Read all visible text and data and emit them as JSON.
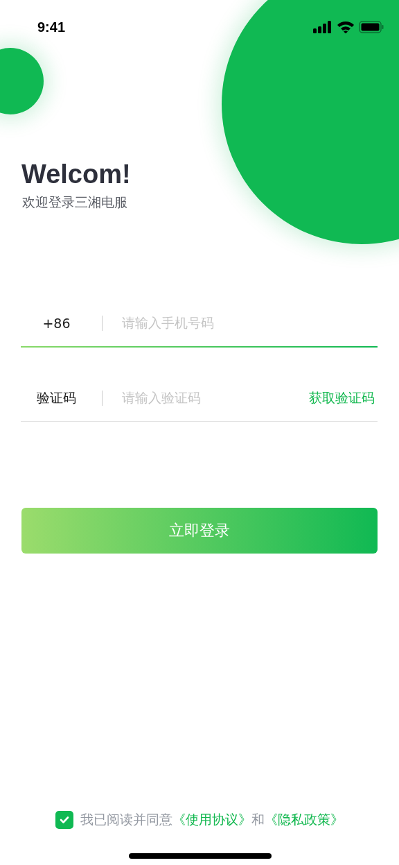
{
  "status_bar": {
    "time": "9:41"
  },
  "heading": {
    "title": "Welcom!",
    "subtitle": "欢迎登录三湘电服"
  },
  "fields": [
    {
      "kind": "phone",
      "prefix": "+86",
      "placeholder": "请输入手机号码",
      "focused": true
    },
    {
      "kind": "code",
      "prefix": "验证码",
      "placeholder": "请输入验证码",
      "action": "获取验证码",
      "focused": false
    }
  ],
  "login_button": "立即登录",
  "agreement": {
    "checked": true,
    "parts": [
      {
        "kind": "text",
        "text": "我已阅读并同意"
      },
      {
        "kind": "link",
        "text": "《使用协议》"
      },
      {
        "kind": "text",
        "text": "和"
      },
      {
        "kind": "link",
        "text": "《隐私政策》"
      }
    ]
  }
}
